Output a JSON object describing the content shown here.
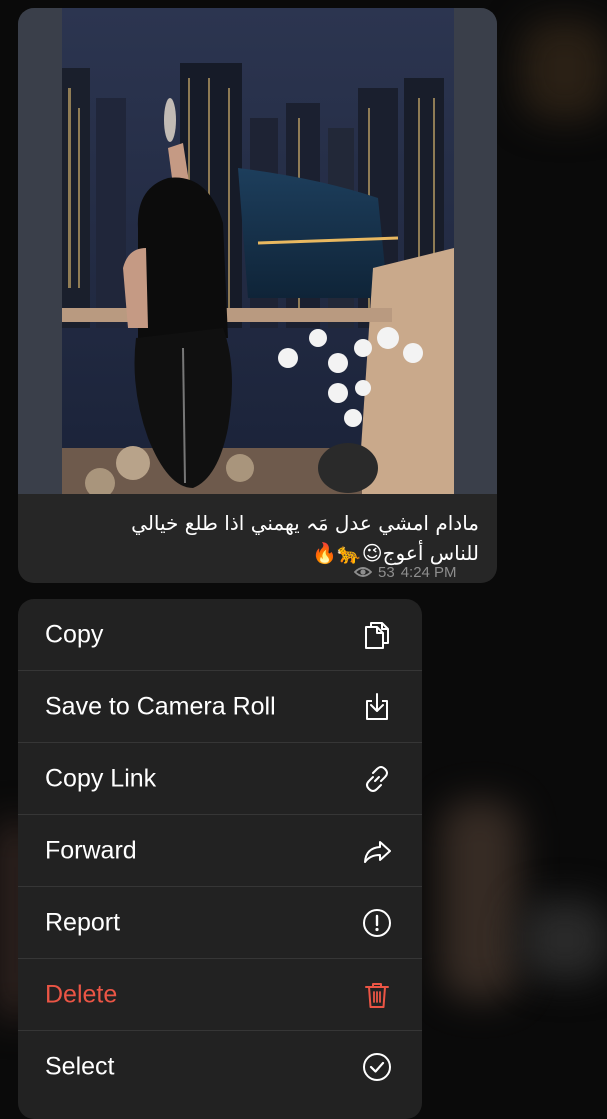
{
  "message": {
    "caption_line1": "مادام امشي عدل مَہ يهمني اذا طلع خيالي",
    "caption_line2": "للناس أعوج😉🐆🔥",
    "views": "53",
    "time": "4:24 PM"
  },
  "menu": {
    "items": [
      {
        "label": "Copy",
        "icon": "copy-icon"
      },
      {
        "label": "Save to Camera Roll",
        "icon": "save-download-icon"
      },
      {
        "label": "Copy Link",
        "icon": "link-icon"
      },
      {
        "label": "Forward",
        "icon": "forward-arrow-icon"
      },
      {
        "label": "Report",
        "icon": "exclamation-circle-icon"
      },
      {
        "label": "Delete",
        "icon": "trash-icon",
        "color": "#eb5545"
      },
      {
        "label": "Select",
        "icon": "checkmark-circle-icon"
      }
    ]
  },
  "colors": {
    "background": "#0a0a0a",
    "bubble": "#262626",
    "menu": "#222222",
    "danger": "#eb5545",
    "meta": "#8e8e8e"
  }
}
